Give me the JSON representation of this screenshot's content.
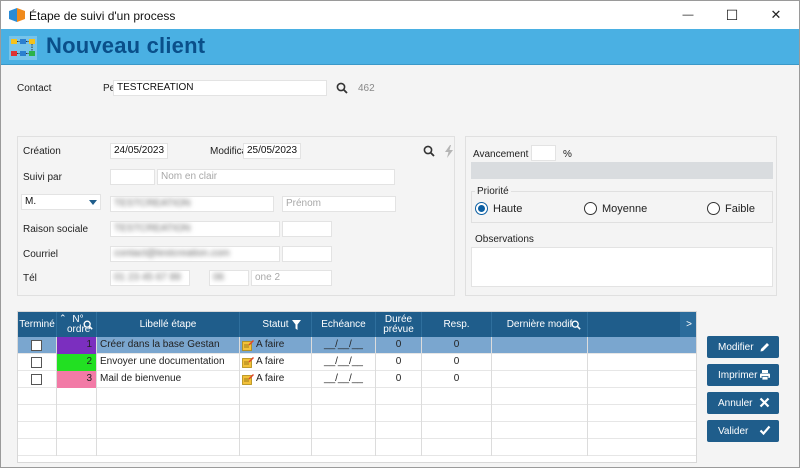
{
  "window": {
    "title": "Étape de suivi d'un process",
    "controls": {
      "minimize": "—",
      "maximize": "☐",
      "close": "✕"
    }
  },
  "header": {
    "title": "Nouveau client"
  },
  "contact": {
    "label": "Contact",
    "prefix": "Pe",
    "value": "TESTCREATION",
    "count": "462"
  },
  "form": {
    "creation_label": "Création",
    "creation_date": "24/05/2023",
    "modif_label": "Modifica",
    "modif_date": "25/05/2023",
    "suivi_label": "Suivi par",
    "suivi_value": "",
    "suivi_placeholder": "Nom en clair",
    "civility": "M.",
    "nom_value": "TESTCREATION",
    "prenom_placeholder": "Prénom",
    "raison_label": "Raison sociale",
    "raison_value": "TESTCREATION",
    "courriel_label": "Courriel",
    "courriel_value": "contact@testcreation.com",
    "tel_label": "Tél",
    "tel_value": "01 23 45 67 89",
    "tel_value2": "06",
    "tel2_placeholder": "one 2"
  },
  "progress": {
    "label": "Avancement",
    "value": "",
    "unit": "%"
  },
  "priority": {
    "label": "Priorité",
    "options": [
      "Haute",
      "Moyenne",
      "Faible"
    ],
    "selected": "Haute"
  },
  "observations": {
    "label": "Observations",
    "value": ""
  },
  "table": {
    "headers": {
      "termine": "Terminé",
      "ordre": "N° ordre",
      "libelle": "Libellé étape",
      "statut": "Statut",
      "echeance": "Echéance",
      "duree": "Durée prévue",
      "resp": "Resp.",
      "derniere": "Dernière modif",
      "scroll": ">"
    },
    "rows": [
      {
        "order": "1",
        "order_color": "#7b2fbf",
        "label": "Créer dans la base Gestan",
        "status": "A faire",
        "echeance": "__/__/__",
        "duree": "0",
        "resp": "0",
        "selected": true
      },
      {
        "order": "2",
        "order_color": "#22e022",
        "label": "Envoyer une documentation",
        "status": "A faire",
        "echeance": "__/__/__",
        "duree": "0",
        "resp": "0",
        "selected": false
      },
      {
        "order": "3",
        "order_color": "#f27aa6",
        "label": "Mail de bienvenue",
        "status": "A faire",
        "echeance": "__/__/__",
        "duree": "0",
        "resp": "0",
        "selected": false
      }
    ]
  },
  "buttons": {
    "modifier": "Modifier",
    "imprimer": "Imprimer",
    "annuler": "Annuler",
    "valider": "Valider"
  },
  "colors": {
    "header_band": "#4ab0e3",
    "header_title": "#0a4f8a",
    "table_header": "#1f5d8b",
    "selected_row": "#7aa6cf",
    "button": "#1f5d8b"
  },
  "icons": {
    "app": "process-app-icon",
    "header": "workflow-icon",
    "search": "search-icon",
    "lightning": "lightning-icon",
    "filter": "filter-icon",
    "sort": "sort-icon",
    "status": "status-edit-icon",
    "pencil": "pencil-icon",
    "printer": "printer-icon",
    "close": "close-icon",
    "check": "check-icon"
  }
}
